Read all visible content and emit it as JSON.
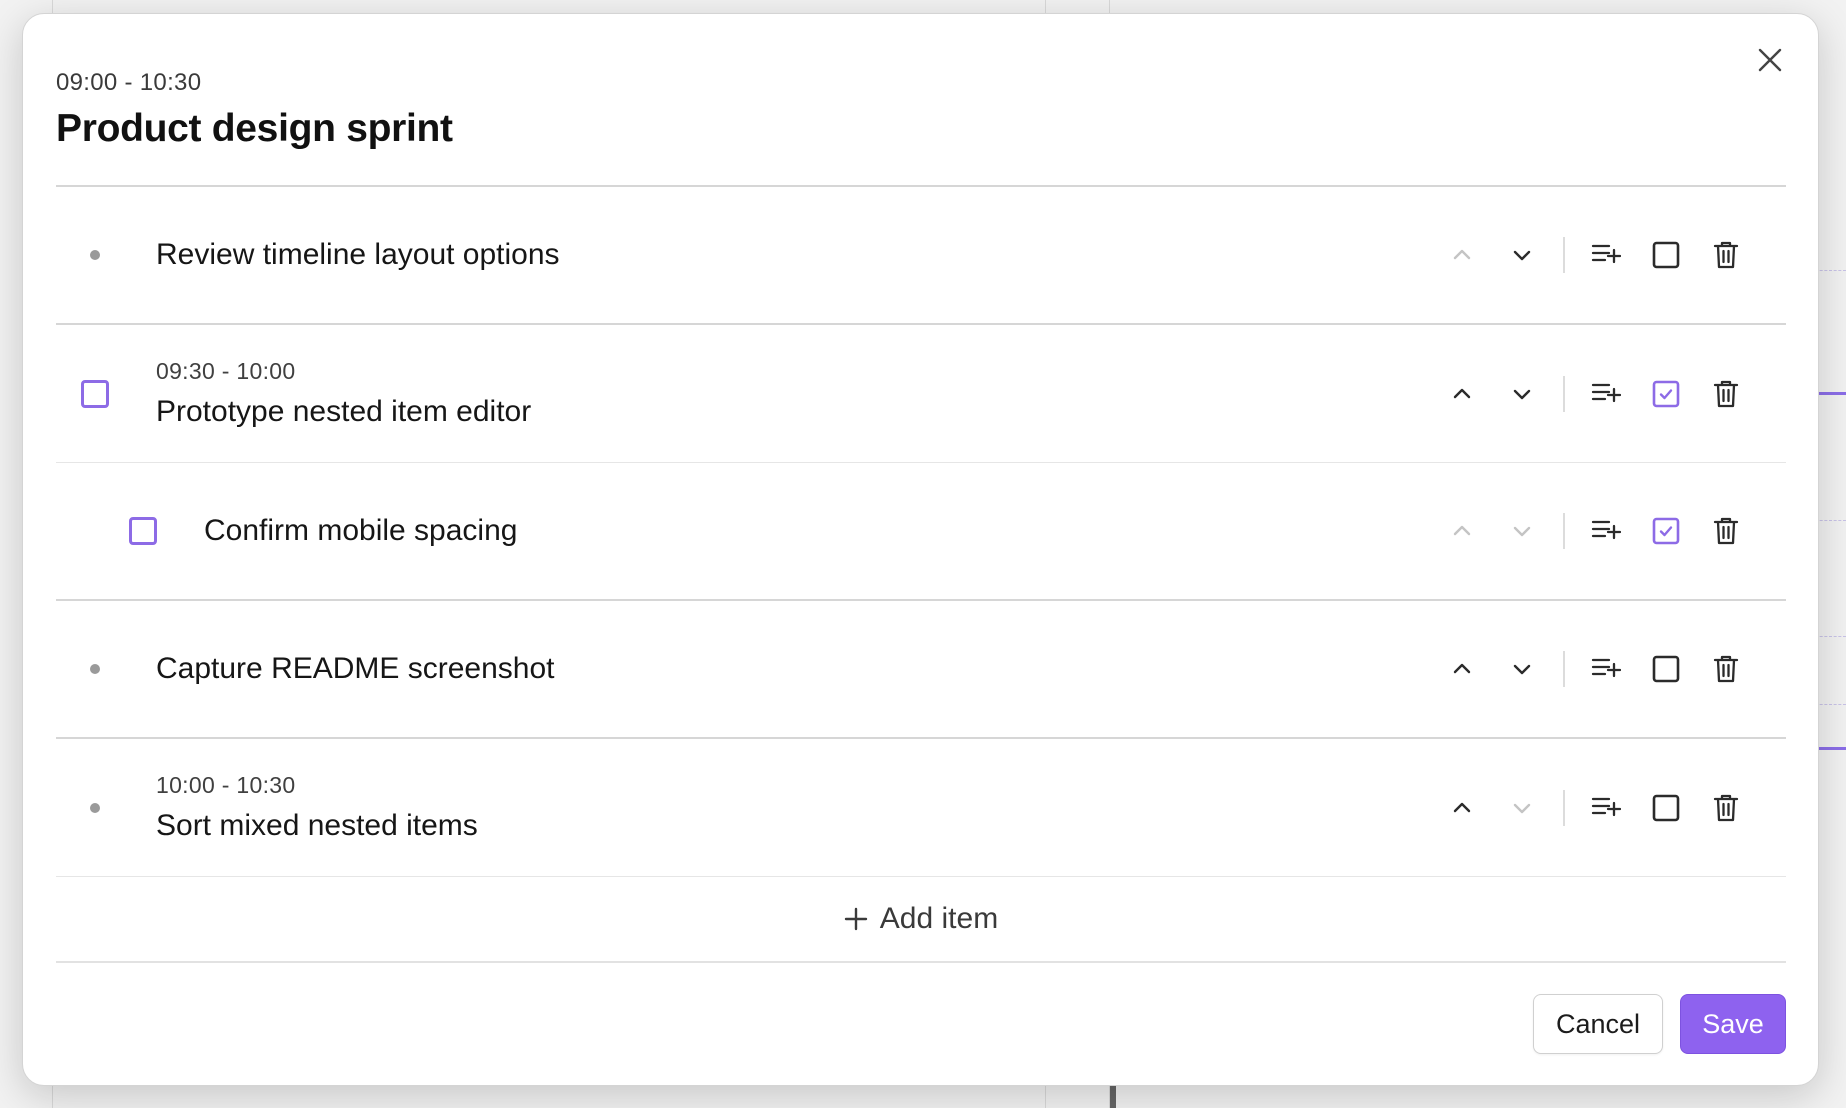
{
  "modal": {
    "time": "09:00 - 10:30",
    "title": "Product design sprint",
    "close_icon": "close-icon"
  },
  "items": [
    {
      "label": "Review timeline layout options",
      "time": "",
      "marker": "bullet",
      "nested": false,
      "up_enabled": false,
      "down_enabled": true,
      "checkbox_toggle": false
    },
    {
      "label": "Prototype nested item editor",
      "time": "09:30 - 10:00",
      "marker": "checkbox",
      "nested": false,
      "up_enabled": true,
      "down_enabled": true,
      "checkbox_toggle": true
    },
    {
      "label": "Confirm mobile spacing",
      "time": "",
      "marker": "checkbox",
      "nested": true,
      "up_enabled": false,
      "down_enabled": false,
      "checkbox_toggle": true
    },
    {
      "label": "Capture README screenshot",
      "time": "",
      "marker": "bullet",
      "nested": false,
      "up_enabled": true,
      "down_enabled": true,
      "checkbox_toggle": false
    },
    {
      "label": "Sort mixed nested items",
      "time": "10:00 - 10:30",
      "marker": "bullet",
      "nested": false,
      "up_enabled": true,
      "down_enabled": false,
      "checkbox_toggle": false
    }
  ],
  "add_item_label": "Add item",
  "footer": {
    "cancel_label": "Cancel",
    "save_label": "Save"
  },
  "colors": {
    "accent": "#8e62ef",
    "checkbox": "#8d6be6",
    "icon": "#2b2b2b",
    "icon_disabled": "#c4c4c4"
  }
}
